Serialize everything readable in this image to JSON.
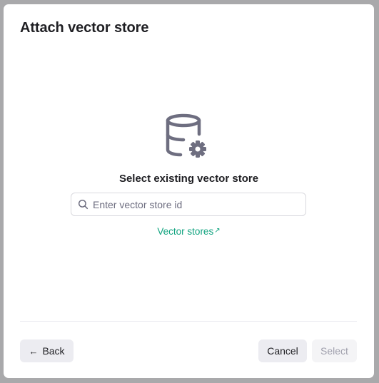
{
  "dialog": {
    "title": "Attach vector store"
  },
  "empty_state": {
    "icon": "database-settings-icon",
    "prompt": "Select existing vector store"
  },
  "search": {
    "icon": "search-icon",
    "placeholder": "Enter vector store id",
    "value": ""
  },
  "link": {
    "label": "Vector stores",
    "arrow": "↗",
    "color": "#10a37f"
  },
  "footer": {
    "back_arrow": "←",
    "back_label": "Back",
    "cancel_label": "Cancel",
    "select_label": "Select",
    "select_disabled": true
  }
}
